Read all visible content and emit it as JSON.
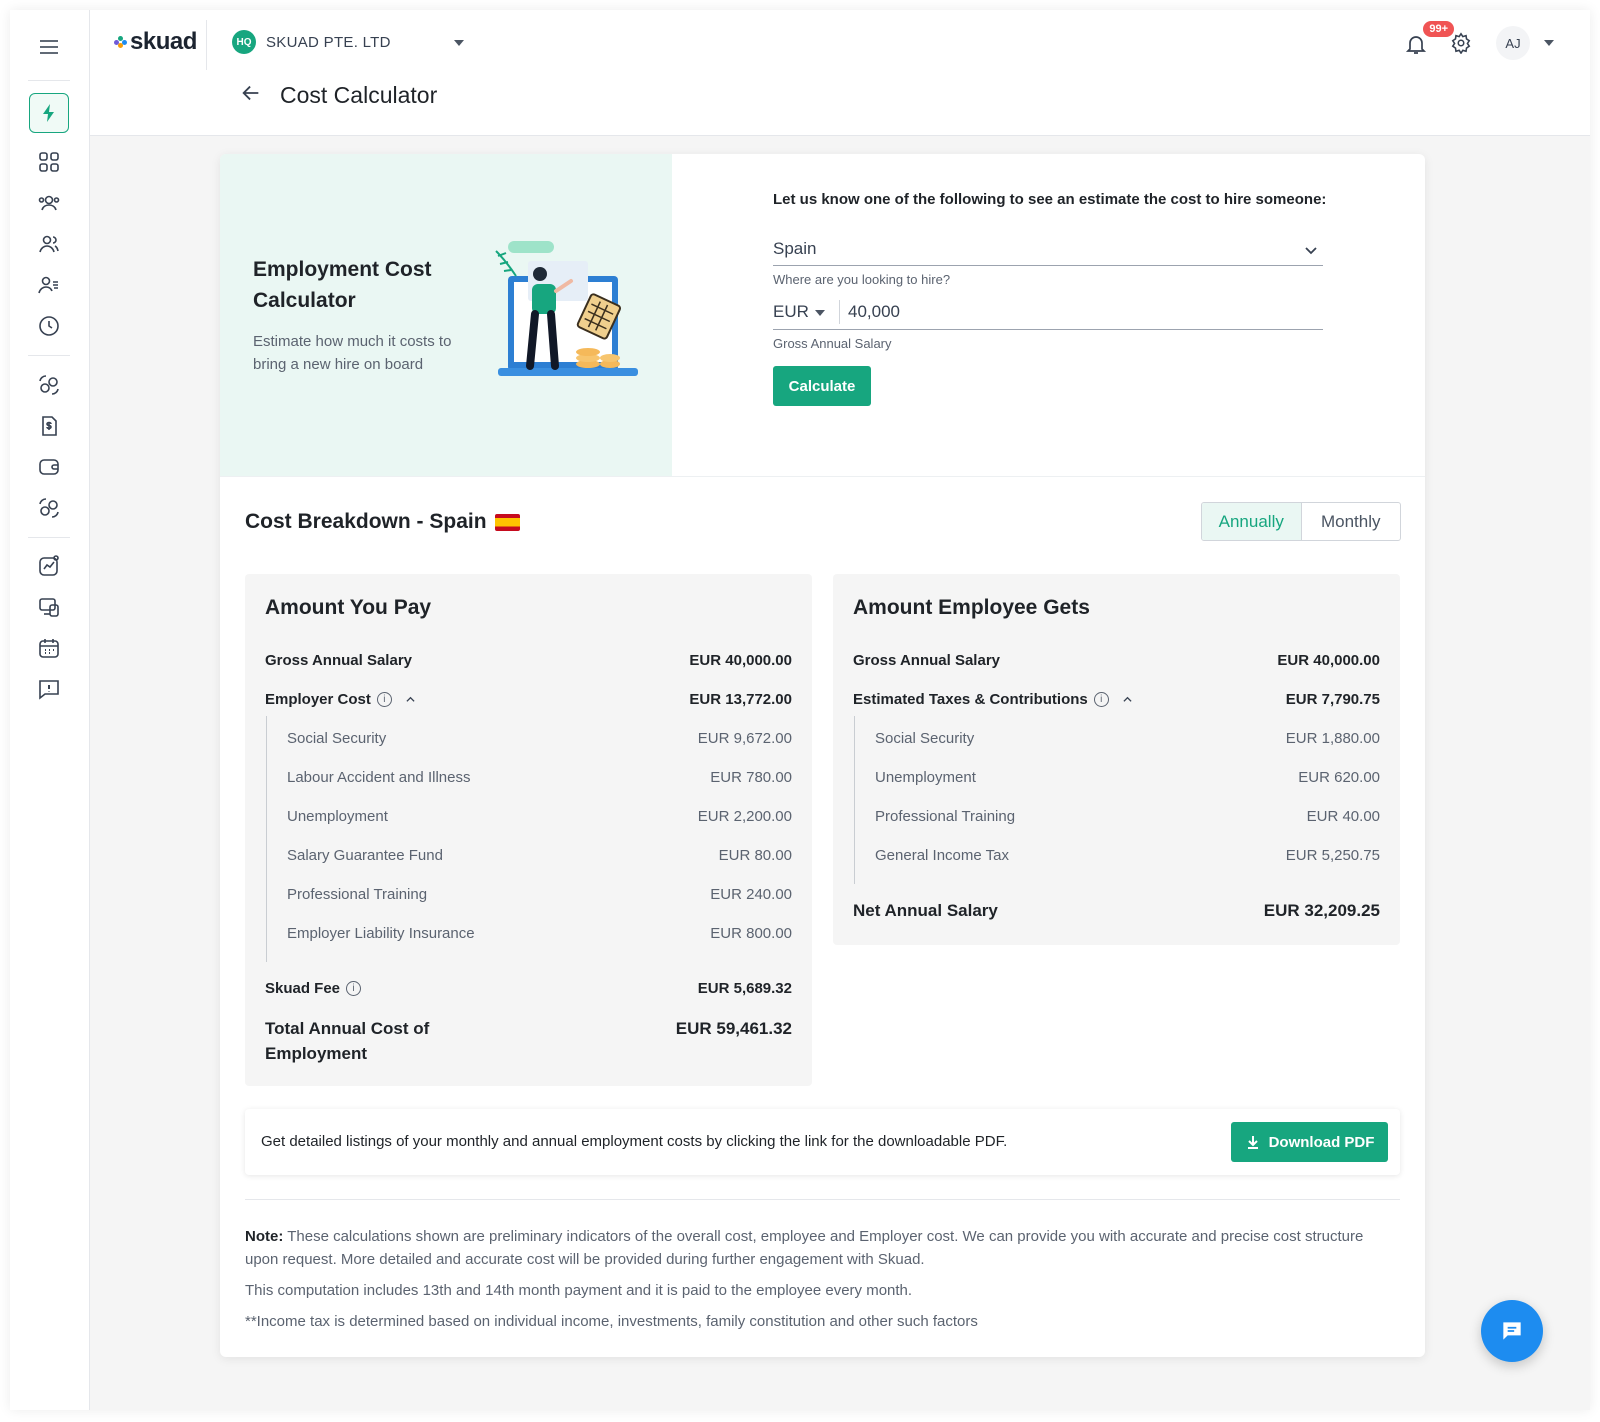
{
  "app": {
    "logo": "skuad"
  },
  "company": {
    "badge": "HQ",
    "name": "SKUAD PTE. LTD"
  },
  "page": {
    "title": "Cost Calculator"
  },
  "notifications": {
    "count": "99+"
  },
  "user": {
    "initials": "AJ"
  },
  "sidebar": {
    "icons": [
      "menu-icon",
      "lightning-icon",
      "grid-icon",
      "team-icon",
      "users-icon",
      "user-list-icon",
      "clock-icon",
      "money-exchange-icon",
      "invoice-icon",
      "wallet-icon",
      "money-exchange-icon",
      "analytics-icon",
      "devices-icon",
      "calendar-icon",
      "feedback-icon"
    ]
  },
  "hero": {
    "title": "Employment Cost Calculator",
    "subtitle": "Estimate how much it costs to bring a new hire on board"
  },
  "form": {
    "lead": "Let us know one of the following to see an estimate the cost to hire someone:",
    "country": "Spain",
    "country_helper": "Where are you looking to hire?",
    "currency": "EUR",
    "salary": "40,000",
    "salary_helper": "Gross Annual Salary",
    "calculate_label": "Calculate"
  },
  "breakdown": {
    "title": "Cost Breakdown - Spain",
    "toggle": {
      "annually": "Annually",
      "monthly": "Monthly",
      "selected": "Annually"
    }
  },
  "you_pay": {
    "title": "Amount You Pay",
    "gross_label": "Gross Annual Salary",
    "gross_value": "EUR 40,000.00",
    "employer_cost_label": "Employer Cost",
    "employer_cost_value": "EUR 13,772.00",
    "items": [
      {
        "label": "Social Security",
        "value": "EUR 9,672.00"
      },
      {
        "label": "Labour Accident and Illness",
        "value": "EUR 780.00"
      },
      {
        "label": "Unemployment",
        "value": "EUR 2,200.00"
      },
      {
        "label": "Salary Guarantee Fund",
        "value": "EUR 80.00"
      },
      {
        "label": "Professional Training",
        "value": "EUR 240.00"
      },
      {
        "label": "Employer Liability Insurance",
        "value": "EUR 800.00"
      }
    ],
    "fee_label": "Skuad Fee",
    "fee_value": "EUR 5,689.32",
    "total_label": "Total Annual Cost of Employment",
    "total_value": "EUR 59,461.32"
  },
  "employee_gets": {
    "title": "Amount Employee Gets",
    "gross_label": "Gross Annual Salary",
    "gross_value": "EUR 40,000.00",
    "taxes_label": "Estimated Taxes & Contributions",
    "taxes_value": "EUR 7,790.75",
    "items": [
      {
        "label": "Social Security",
        "value": "EUR 1,880.00"
      },
      {
        "label": "Unemployment",
        "value": "EUR 620.00"
      },
      {
        "label": "Professional Training",
        "value": "EUR 40.00"
      },
      {
        "label": "General Income Tax",
        "value": "EUR 5,250.75"
      }
    ],
    "net_label": "Net Annual Salary",
    "net_value": "EUR 32,209.25"
  },
  "pdf": {
    "text": "Get detailed listings of your monthly and annual employment costs by clicking the link for the downloadable PDF.",
    "button": "Download PDF"
  },
  "notes": {
    "note_label": "Note:",
    "note_text": " These calculations shown are preliminary indicators of the overall cost, employee and Employer cost. We can provide you with accurate and precise cost structure upon request. More detailed and accurate cost will be provided during further engagement with Skuad.",
    "line2": "This computation includes 13th and 14th month payment and it is paid to the employee every month.",
    "line3": "**Income tax is determined based on individual income, investments, family constitution and other such factors"
  },
  "colors": {
    "accent": "#17a67f",
    "hero_bg": "#eaf7f3",
    "chat": "#1d8cf0",
    "badge": "#f05454"
  }
}
